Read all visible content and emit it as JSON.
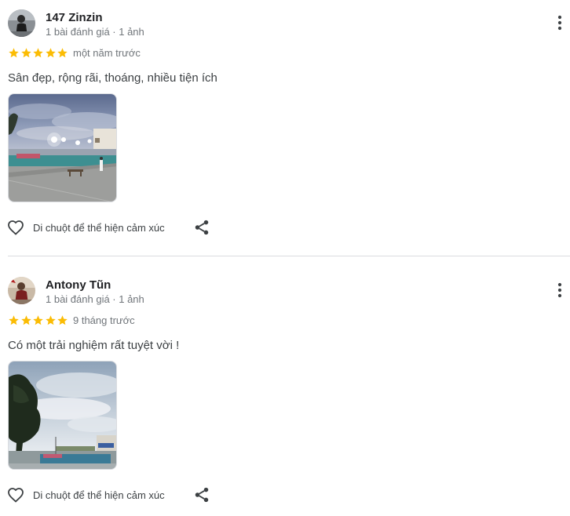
{
  "reviews": [
    {
      "author": "147 Zinzin",
      "meta": "1 bài đánh giá · 1 ảnh",
      "rating": 5,
      "date": "một năm trước",
      "text": "Sân đẹp, rộng rãi, thoáng, nhiều tiện ích",
      "reaction_label": "Di chuột để thể hiện cảm xúc"
    },
    {
      "author": "Antony Tũn",
      "meta": "1 bài đánh giá · 1 ảnh",
      "rating": 5,
      "date": "9 tháng trước",
      "text": "Có một trải nghiệm rất tuyệt vời !",
      "reaction_label": "Di chuột để thể hiện cảm xúc"
    }
  ],
  "colors": {
    "star": "#fbbc04",
    "icon": "#5f6368",
    "divider": "#dadce0"
  },
  "icons": {
    "more": "more-vert-icon",
    "reaction": "heart-outline-icon",
    "share": "share-icon",
    "star": "star-icon"
  }
}
